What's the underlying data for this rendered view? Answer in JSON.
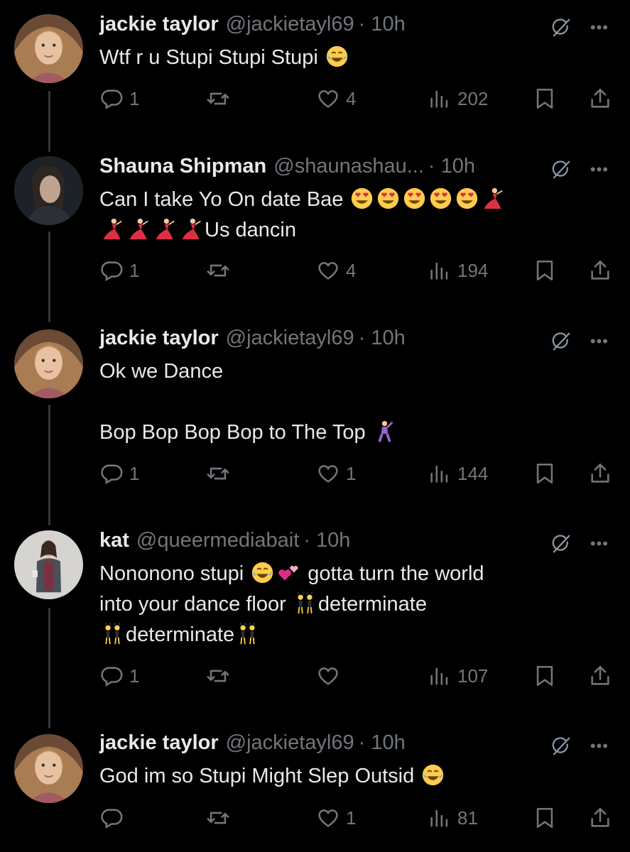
{
  "tweets": [
    {
      "name": "jackie taylor",
      "handle": "@jackietayl69",
      "time": "· 10h",
      "lines": [
        {
          "text": "Wtf r u Stupi Stupi Stupi ",
          "emojis": [
            "laughing-tears"
          ]
        }
      ],
      "replies": "1",
      "reposts": "",
      "likes": "4",
      "views": "202"
    },
    {
      "name": "Shauna Shipman",
      "handle": "@shaunashau...",
      "time": "· 10h",
      "lines": [
        {
          "text": "Can I take Yo On date Bae ",
          "emojis": [
            "heart-eyes",
            "heart-eyes",
            "heart-eyes",
            "heart-eyes",
            "heart-eyes",
            "dancer"
          ]
        },
        {
          "text": "",
          "emojis": [
            "dancer",
            "dancer",
            "dancer",
            "dancer"
          ],
          "suffix": "Us dancin"
        }
      ],
      "replies": "1",
      "reposts": "",
      "likes": "4",
      "views": "194"
    },
    {
      "name": "jackie taylor",
      "handle": "@jackietayl69",
      "time": "· 10h",
      "lines": [
        {
          "text": "Ok we Dance",
          "emojis": []
        },
        {
          "text": "",
          "emojis": []
        },
        {
          "text": "Bop Bop Bop Bop to The Top ",
          "emojis": [
            "man-dancing"
          ]
        }
      ],
      "replies": "1",
      "reposts": "",
      "likes": "1",
      "views": "144"
    },
    {
      "name": "kat",
      "handle": "@queermediabait",
      "time": "· 10h",
      "lines": [
        {
          "text": "Nononono stupi ",
          "emojis": [
            "laughing-tears",
            "two-hearts"
          ],
          "suffix": " gotta turn the world"
        },
        {
          "text": "into your dance floor ",
          "emojis": [
            "bunny-dancers"
          ],
          "suffix": "determinate"
        },
        {
          "text": "",
          "emojis": [
            "bunny-dancers"
          ],
          "suffix": "determinate",
          "emojis_after": [
            "bunny-dancers"
          ]
        }
      ],
      "replies": "1",
      "reposts": "",
      "likes": "",
      "views": "107"
    },
    {
      "name": "jackie taylor",
      "handle": "@jackietayl69",
      "time": "· 10h",
      "lines": [
        {
          "text": "God im so Stupi Might Slep Outsid ",
          "emojis": [
            "laughing-tears"
          ]
        }
      ],
      "replies": "",
      "reposts": "",
      "likes": "1",
      "views": "81"
    }
  ],
  "icons": {
    "reply": "reply-icon",
    "repost": "repost-icon",
    "like": "heart-icon",
    "views": "views-icon",
    "bookmark": "bookmark-icon",
    "share": "share-icon",
    "grok": "grok-icon",
    "more": "more-icon"
  },
  "colors": {
    "background": "#000000",
    "text": "#e7e9ea",
    "muted": "#71767b",
    "thread": "#333639"
  }
}
